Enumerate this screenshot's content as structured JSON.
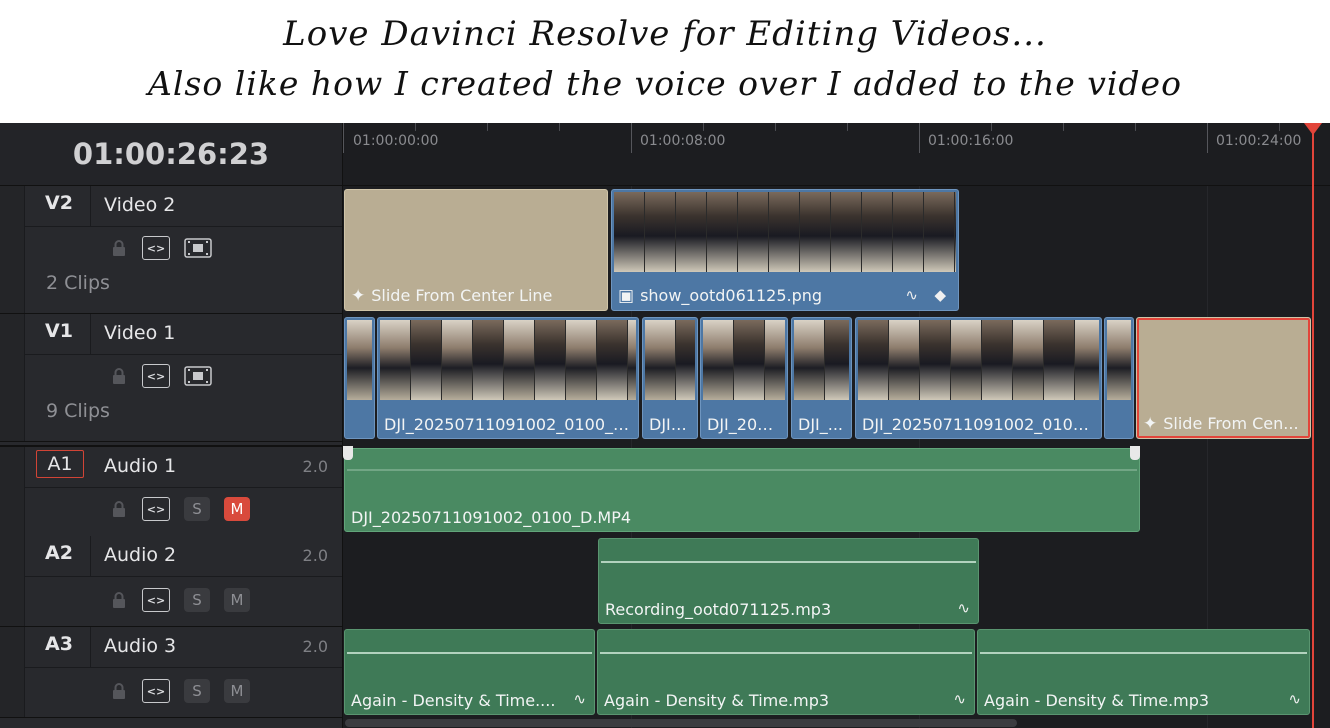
{
  "banner": {
    "line1": "Love Davinci Resolve for Editing Videos...",
    "line2": "Also like how I created the voice over I added to the video"
  },
  "timecode": "01:00:26:23",
  "ruler": {
    "labels": [
      "01:00:00:00",
      "01:00:08:00",
      "01:00:16:00",
      "01:00:24:00"
    ]
  },
  "tracks": {
    "v2": {
      "id": "V2",
      "name": "Video 2",
      "clips": "2 Clips"
    },
    "v1": {
      "id": "V1",
      "name": "Video 1",
      "clips": "9 Clips"
    },
    "a1": {
      "id": "A1",
      "name": "Audio 1",
      "level": "2.0",
      "solo": "S",
      "mute": "M"
    },
    "a2": {
      "id": "A2",
      "name": "Audio 2",
      "level": "2.0",
      "solo": "S",
      "mute": "M"
    },
    "a3": {
      "id": "A3",
      "name": "Audio 3",
      "level": "2.0",
      "solo": "S",
      "mute": "M"
    }
  },
  "clips": {
    "v2": [
      "Slide From Center Line",
      "show_ootd061125.png"
    ],
    "v1": [
      "DJI_20250711091002_0100_D....",
      "DJI_...",
      "DJI_202...",
      "DJI_...",
      "DJI_20250711091002_0100_...",
      "Slide From Cen..."
    ],
    "a1": [
      "DJI_20250711091002_0100_D.MP4"
    ],
    "a2": [
      "Recording_ootd071125.mp3"
    ],
    "a3": [
      "Again - Density & Time....",
      "Again - Density & Time.mp3",
      "Again - Density & Time.mp3"
    ]
  },
  "colors": {
    "video_clip": "#4d77a4",
    "transition_clip": "#b9ad93",
    "audio_clip": "#4a8a62",
    "playhead": "#e2453a",
    "mute_active": "#d94a3c"
  }
}
